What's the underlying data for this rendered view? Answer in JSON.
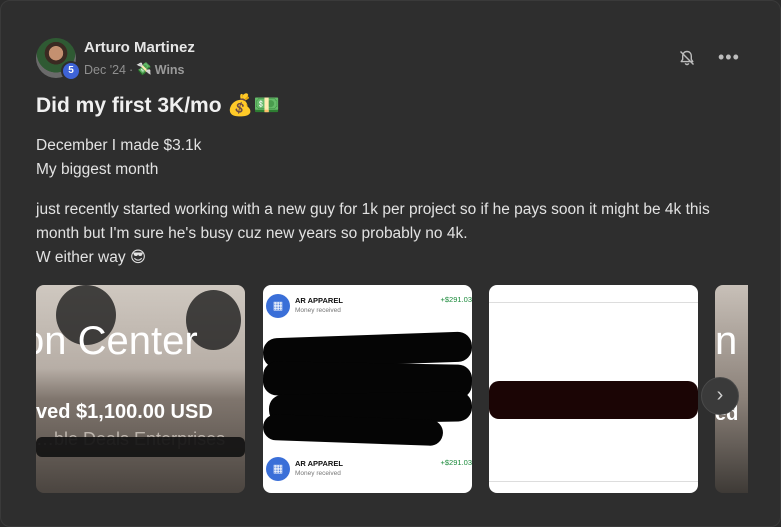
{
  "post": {
    "author": "Arturo Martinez",
    "level": "5",
    "date": "Dec '24",
    "separator": "·",
    "category_emoji": "💸",
    "category": "Wins",
    "title": "Did my first 3K/mo 💰💵",
    "paragraphs": [
      "December I made $3.1k",
      "My biggest month",
      "just recently started working with a new guy for 1k per project so if he pays soon it might be 4k this month but I'm sure he's busy cuz new years so probably no 4k.",
      "W either way 😎"
    ]
  },
  "actions": {
    "more_glyph": "•••"
  },
  "gallery": {
    "image1": {
      "line1": "on Center",
      "line2": "ved $1,100.00 USD",
      "line3": "…ble Deals Enterprises"
    },
    "image2": {
      "transactions": [
        {
          "name": "AR APPAREL",
          "status": "Money received",
          "amount": "+$291.03"
        },
        {
          "name": "AR APPAREL",
          "status": "Money received",
          "amount": "+$291.03"
        }
      ]
    },
    "image4": {
      "line1": "n",
      "line2": "ed"
    },
    "next_glyph": "›"
  },
  "colors": {
    "background": "#2e2e2e",
    "level_badge": "#3e63d6",
    "amount_green": "#1a8a3a"
  }
}
